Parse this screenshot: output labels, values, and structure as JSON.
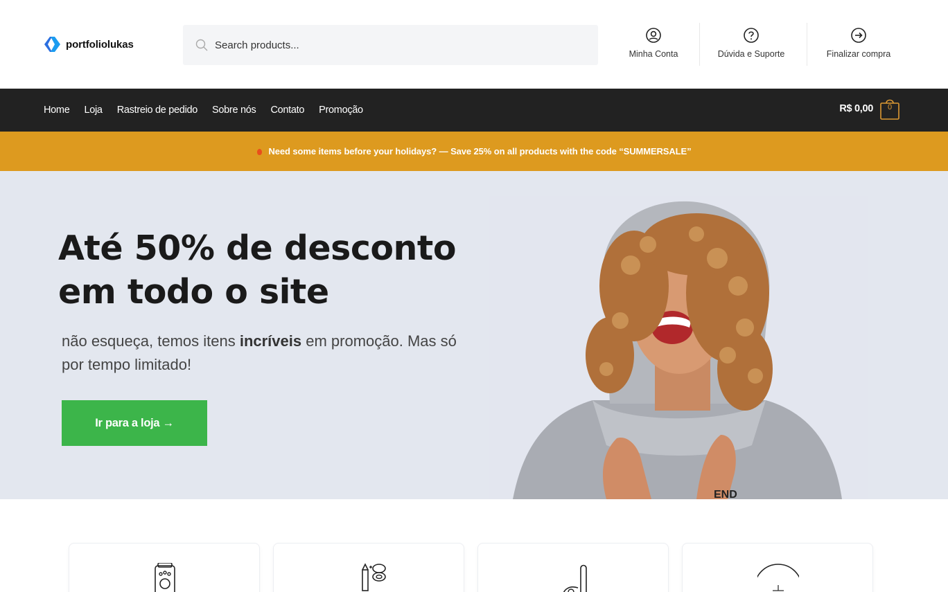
{
  "header": {
    "logo_text": "portfoliolukas",
    "search_placeholder": "Search products...",
    "nav_items": [
      {
        "label": "Minha Conta",
        "icon": "user-circle-icon"
      },
      {
        "label": "Dúvida e Suporte",
        "icon": "question-circle-icon"
      },
      {
        "label": "Finalizar compra",
        "icon": "arrow-right-circle-icon"
      }
    ]
  },
  "navbar": {
    "menu": [
      "Home",
      "Loja",
      "Rastreio de pedido",
      "Sobre nós",
      "Contato",
      "Promoção"
    ],
    "cart_total": "R$ 0,00",
    "cart_count": "0"
  },
  "promo": {
    "text": "Need some items before your holidays? — Save 25% on all products with the code “SUMMERSALE”"
  },
  "hero": {
    "title_line1": "Até 50% de desconto",
    "title_line2": "em todo o site",
    "subtitle_before": "não esqueça, temos itens ",
    "subtitle_bold": "incríveis",
    "subtitle_after": " em promoção. Mas só por tempo limitado!",
    "button_label": "Ir para a loja →"
  },
  "categories": [
    {
      "icon": "speaker-icon"
    },
    {
      "icon": "cosmetics-icon"
    },
    {
      "icon": "vacuum-icon"
    },
    {
      "icon": "clock-icon"
    }
  ],
  "colors": {
    "navbar_bg": "#222222",
    "promo_bg": "#dd9a1f",
    "hero_bg": "#e3e7ef",
    "button_bg": "#3cb54a",
    "accent": "#dd9933"
  }
}
